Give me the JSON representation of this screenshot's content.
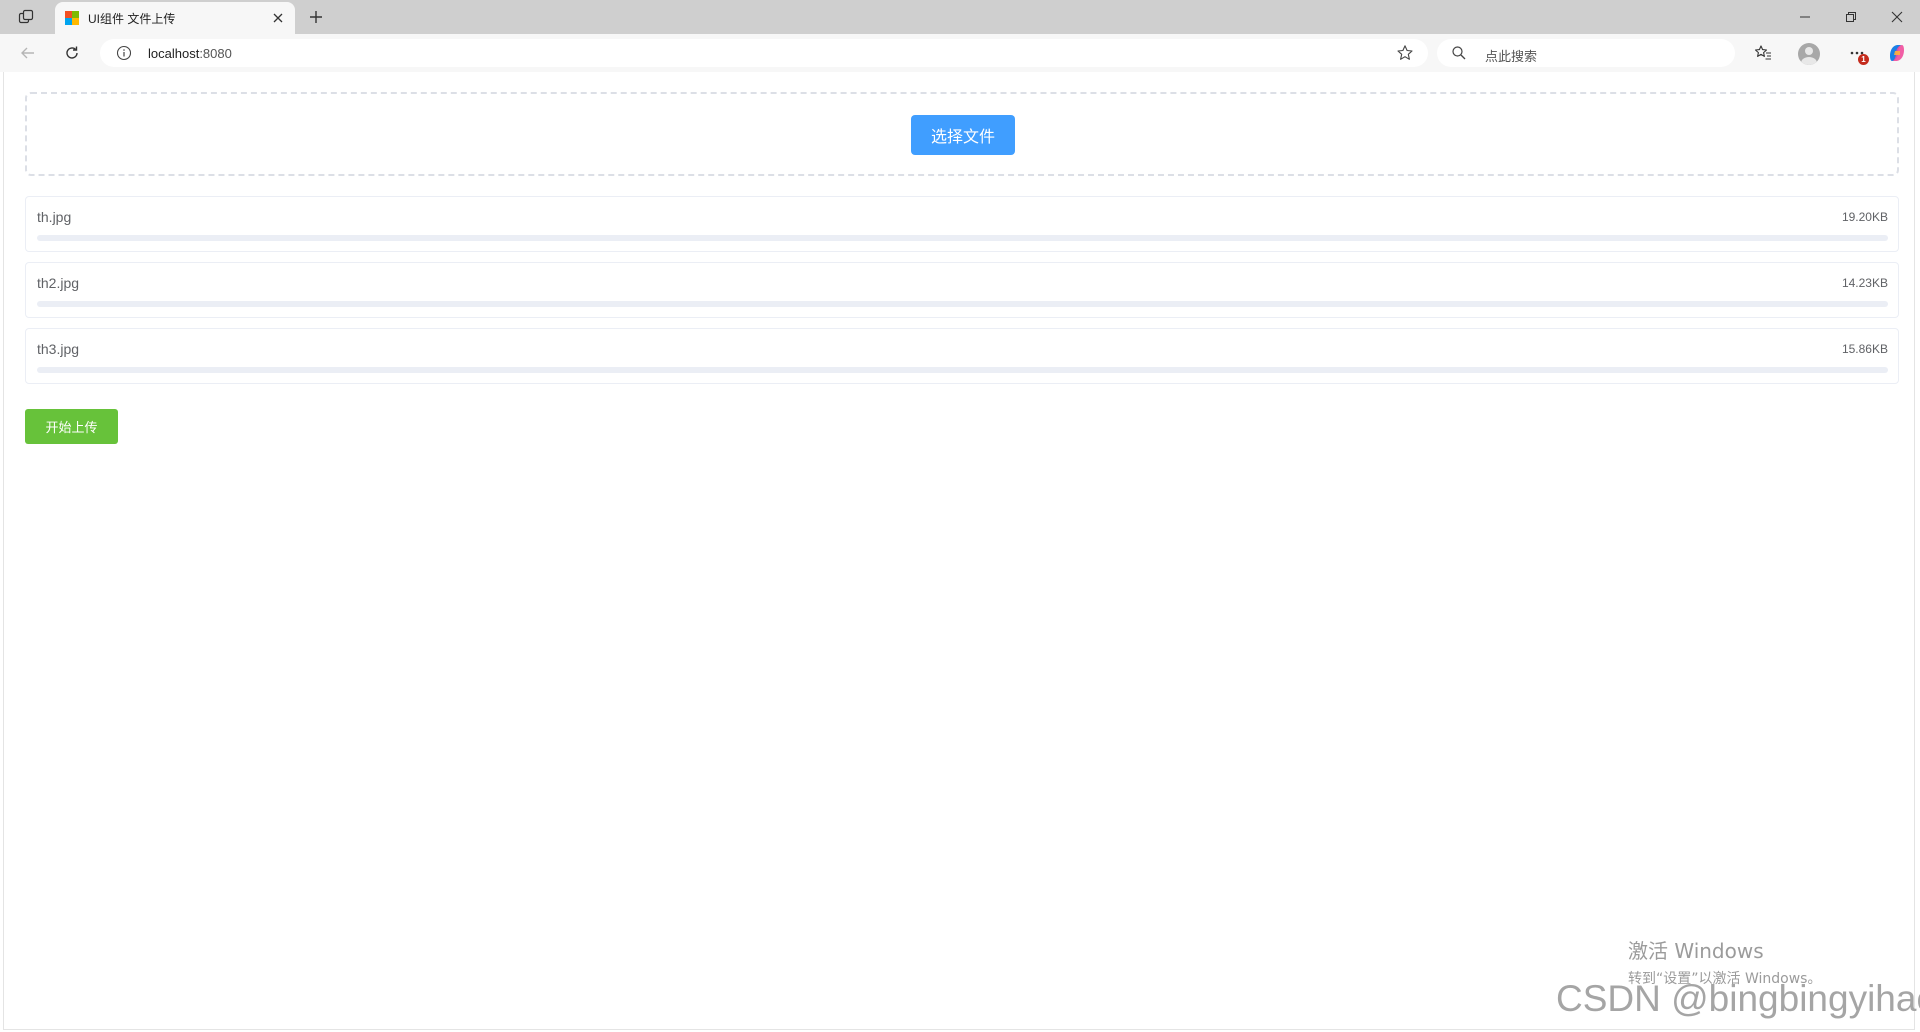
{
  "browser": {
    "tab_title": "UI组件 文件上传",
    "url_host": "localhost",
    "url_port": ":8080",
    "search_placeholder": "点此搜索",
    "notification_count": "1"
  },
  "upload": {
    "select_button": "选择文件",
    "start_button": "开始上传",
    "files": [
      {
        "name": "th.jpg",
        "size": "19.20KB",
        "progress": 0
      },
      {
        "name": "th2.jpg",
        "size": "14.23KB",
        "progress": 0
      },
      {
        "name": "th3.jpg",
        "size": "15.86KB",
        "progress": 0
      }
    ]
  },
  "overlay": {
    "activate_title": "激活 Windows",
    "activate_hint": "转到“设置”以激活 Windows。",
    "watermark": "CSDN @bingbingyihao"
  },
  "colors": {
    "primary": "#409eff",
    "success": "#67c23a",
    "border": "#ebeef5"
  }
}
